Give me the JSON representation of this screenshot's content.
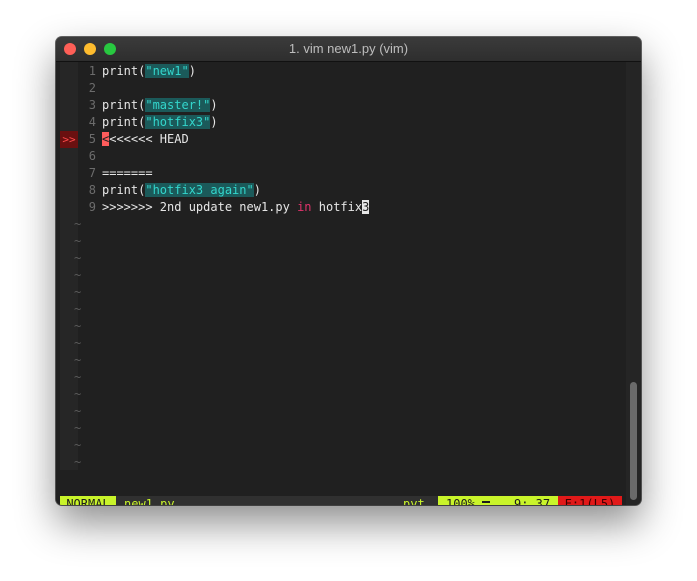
{
  "window": {
    "title": "1. vim new1.py (vim)"
  },
  "editor": {
    "lines": [
      {
        "num": "1",
        "parts": [
          {
            "t": "print(",
            "c": ""
          },
          {
            "t": "\"new1\"",
            "c": "str"
          },
          {
            "t": ")",
            "c": ""
          }
        ]
      },
      {
        "num": "2",
        "parts": []
      },
      {
        "num": "3",
        "parts": [
          {
            "t": "print(",
            "c": ""
          },
          {
            "t": "\"master!\"",
            "c": "str"
          },
          {
            "t": ")",
            "c": ""
          }
        ]
      },
      {
        "num": "4",
        "parts": [
          {
            "t": "print(",
            "c": ""
          },
          {
            "t": "\"hotfix3\"",
            "c": "str"
          },
          {
            "t": ")",
            "c": ""
          }
        ]
      },
      {
        "num": "5",
        "sign": ">>",
        "parts": [
          {
            "t": "<",
            "c": "cursor"
          },
          {
            "t": "<<<<<< HEAD",
            "c": ""
          }
        ]
      },
      {
        "num": "6",
        "parts": []
      },
      {
        "num": "7",
        "parts": [
          {
            "t": "=======",
            "c": ""
          }
        ]
      },
      {
        "num": "8",
        "parts": [
          {
            "t": "print(",
            "c": ""
          },
          {
            "t": "\"hotfix3 again\"",
            "c": "str"
          },
          {
            "t": ")",
            "c": ""
          }
        ]
      },
      {
        "num": "9",
        "parts": [
          {
            "t": ">>>>>>> 2nd update new1.py ",
            "c": ""
          },
          {
            "t": "in",
            "c": "kw"
          },
          {
            "t": " hotfix",
            "c": ""
          },
          {
            "t": "3",
            "c": "cursor-end"
          }
        ]
      }
    ],
    "tilde_char": "~"
  },
  "statusline": {
    "mode": "NORMAL",
    "filename": "new1.py",
    "filetype": "pyt…",
    "percent": "100%",
    "position": "9: 37",
    "error": "E:1(L5)"
  }
}
